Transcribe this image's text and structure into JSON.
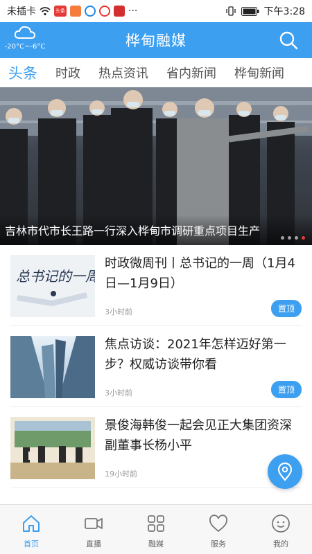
{
  "status_bar": {
    "carrier": "未插卡",
    "app_badge_1": "头条",
    "more": "···",
    "time": "下午3:28"
  },
  "header": {
    "title": "桦甸融媒",
    "weather": {
      "temperature": "-20°C~-6°C",
      "icon": "cloud-icon"
    },
    "search_icon": "search-icon"
  },
  "tabs": [
    {
      "label": "头条",
      "active": true
    },
    {
      "label": "时政"
    },
    {
      "label": "热点资讯"
    },
    {
      "label": "省内新闻"
    },
    {
      "label": "桦甸新闻"
    }
  ],
  "banner": {
    "caption": "吉林市代市长王路一行深入桦甸市调研重点项目生产",
    "dots": 4,
    "active_dot": 3
  },
  "news": [
    {
      "title": "时政微周刊丨总书记的一周（1月4日—1月9日）",
      "time": "3小时前",
      "badge": "置顶",
      "thumb_text": "总书记的一周"
    },
    {
      "title": "焦点访谈：2021年怎样迈好第一步？权威访谈带你看",
      "time": "3小时前",
      "badge": "置顶"
    },
    {
      "title": "景俊海韩俊一起会见正大集团资深副董事长杨小平",
      "time": "19小时前"
    }
  ],
  "bottom_nav": [
    {
      "label": "首页",
      "icon": "home-icon",
      "active": true
    },
    {
      "label": "直播",
      "icon": "video-camera-icon"
    },
    {
      "label": "融媒",
      "icon": "grid-apps-icon"
    },
    {
      "label": "服务",
      "icon": "heart-icon"
    },
    {
      "label": "我的",
      "icon": "smile-face-icon"
    }
  ],
  "colors": {
    "accent": "#3d9ff0",
    "active_dot": "#e53935"
  }
}
